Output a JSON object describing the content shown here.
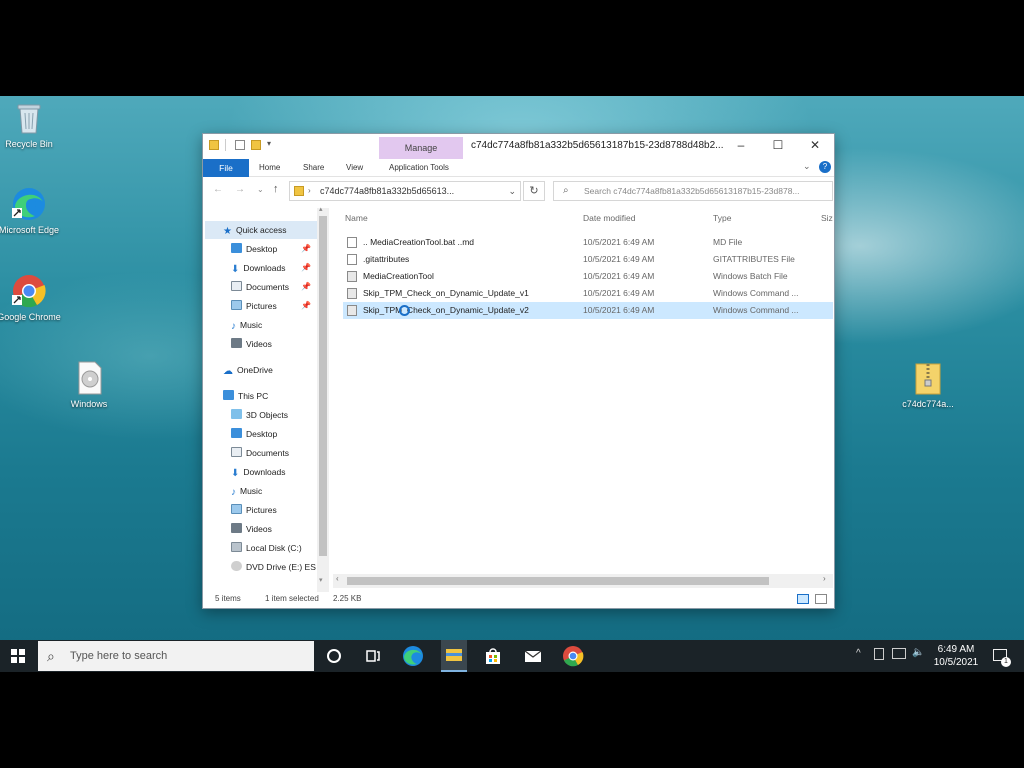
{
  "desktop": {
    "icons": [
      {
        "label": "Recycle Bin"
      },
      {
        "label": "Microsoft Edge"
      },
      {
        "label": "Google Chrome"
      },
      {
        "label": "Windows"
      },
      {
        "label": "c74dc774a..."
      }
    ]
  },
  "explorer": {
    "title": "c74dc774a8fb81a332b5d65613187b15-23d8788d48b2...",
    "manage_tab": "Manage",
    "ribbon": {
      "file": "File",
      "home": "Home",
      "share": "Share",
      "view": "View",
      "app_tools": "Application Tools"
    },
    "address": "c74dc774a8fb81a332b5d65613...",
    "search_placeholder": "Search c74dc774a8fb81a332b5d65613187b15-23d878...",
    "nav": {
      "quick_access": "Quick access",
      "qa_items": [
        "Desktop",
        "Downloads",
        "Documents",
        "Pictures",
        "Music",
        "Videos"
      ],
      "onedrive": "OneDrive",
      "this_pc": "This PC",
      "pc_items": [
        "3D Objects",
        "Desktop",
        "Documents",
        "Downloads",
        "Music",
        "Pictures",
        "Videos",
        "Local Disk (C:)",
        "DVD Drive (E:) ES"
      ]
    },
    "columns": {
      "name": "Name",
      "date": "Date modified",
      "type": "Type",
      "size": "Siz"
    },
    "files": [
      {
        "name": ".. MediaCreationTool.bat ..md",
        "date": "10/5/2021 6:49 AM",
        "type": "MD File"
      },
      {
        "name": ".gitattributes",
        "date": "10/5/2021 6:49 AM",
        "type": "GITATTRIBUTES File"
      },
      {
        "name": "MediaCreationTool",
        "date": "10/5/2021 6:49 AM",
        "type": "Windows Batch File"
      },
      {
        "name": "Skip_TPM_Check_on_Dynamic_Update_v1",
        "date": "10/5/2021 6:49 AM",
        "type": "Windows Command ..."
      },
      {
        "name": "Skip_TPM_Check_on_Dynamic_Update_v2",
        "date": "10/5/2021 6:49 AM",
        "type": "Windows Command ..."
      }
    ],
    "status": {
      "items": "5 items",
      "selected": "1 item selected",
      "size": "2.25 KB"
    }
  },
  "taskbar": {
    "search_placeholder": "Type here to search",
    "time": "6:49 AM",
    "date": "10/5/2021",
    "notification_count": "1"
  },
  "colors": {
    "accent": "#1a6fc8",
    "selection": "#cce8ff",
    "manage": "#e2c8ef",
    "taskbar": "#1b2328"
  }
}
